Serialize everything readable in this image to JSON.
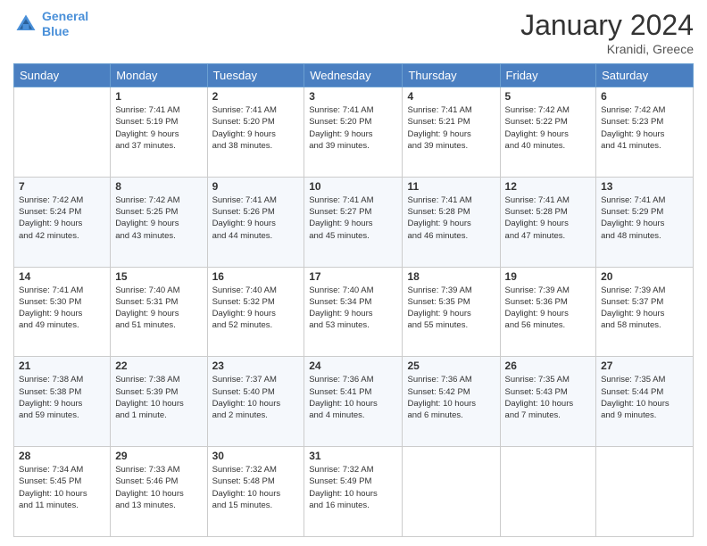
{
  "header": {
    "logo_line1": "General",
    "logo_line2": "Blue",
    "month_title": "January 2024",
    "location": "Kranidi, Greece"
  },
  "days_of_week": [
    "Sunday",
    "Monday",
    "Tuesday",
    "Wednesday",
    "Thursday",
    "Friday",
    "Saturday"
  ],
  "weeks": [
    [
      {
        "day": "",
        "info": ""
      },
      {
        "day": "1",
        "info": "Sunrise: 7:41 AM\nSunset: 5:19 PM\nDaylight: 9 hours\nand 37 minutes."
      },
      {
        "day": "2",
        "info": "Sunrise: 7:41 AM\nSunset: 5:20 PM\nDaylight: 9 hours\nand 38 minutes."
      },
      {
        "day": "3",
        "info": "Sunrise: 7:41 AM\nSunset: 5:20 PM\nDaylight: 9 hours\nand 39 minutes."
      },
      {
        "day": "4",
        "info": "Sunrise: 7:41 AM\nSunset: 5:21 PM\nDaylight: 9 hours\nand 39 minutes."
      },
      {
        "day": "5",
        "info": "Sunrise: 7:42 AM\nSunset: 5:22 PM\nDaylight: 9 hours\nand 40 minutes."
      },
      {
        "day": "6",
        "info": "Sunrise: 7:42 AM\nSunset: 5:23 PM\nDaylight: 9 hours\nand 41 minutes."
      }
    ],
    [
      {
        "day": "7",
        "info": "Sunrise: 7:42 AM\nSunset: 5:24 PM\nDaylight: 9 hours\nand 42 minutes."
      },
      {
        "day": "8",
        "info": "Sunrise: 7:42 AM\nSunset: 5:25 PM\nDaylight: 9 hours\nand 43 minutes."
      },
      {
        "day": "9",
        "info": "Sunrise: 7:41 AM\nSunset: 5:26 PM\nDaylight: 9 hours\nand 44 minutes."
      },
      {
        "day": "10",
        "info": "Sunrise: 7:41 AM\nSunset: 5:27 PM\nDaylight: 9 hours\nand 45 minutes."
      },
      {
        "day": "11",
        "info": "Sunrise: 7:41 AM\nSunset: 5:28 PM\nDaylight: 9 hours\nand 46 minutes."
      },
      {
        "day": "12",
        "info": "Sunrise: 7:41 AM\nSunset: 5:28 PM\nDaylight: 9 hours\nand 47 minutes."
      },
      {
        "day": "13",
        "info": "Sunrise: 7:41 AM\nSunset: 5:29 PM\nDaylight: 9 hours\nand 48 minutes."
      }
    ],
    [
      {
        "day": "14",
        "info": "Sunrise: 7:41 AM\nSunset: 5:30 PM\nDaylight: 9 hours\nand 49 minutes."
      },
      {
        "day": "15",
        "info": "Sunrise: 7:40 AM\nSunset: 5:31 PM\nDaylight: 9 hours\nand 51 minutes."
      },
      {
        "day": "16",
        "info": "Sunrise: 7:40 AM\nSunset: 5:32 PM\nDaylight: 9 hours\nand 52 minutes."
      },
      {
        "day": "17",
        "info": "Sunrise: 7:40 AM\nSunset: 5:34 PM\nDaylight: 9 hours\nand 53 minutes."
      },
      {
        "day": "18",
        "info": "Sunrise: 7:39 AM\nSunset: 5:35 PM\nDaylight: 9 hours\nand 55 minutes."
      },
      {
        "day": "19",
        "info": "Sunrise: 7:39 AM\nSunset: 5:36 PM\nDaylight: 9 hours\nand 56 minutes."
      },
      {
        "day": "20",
        "info": "Sunrise: 7:39 AM\nSunset: 5:37 PM\nDaylight: 9 hours\nand 58 minutes."
      }
    ],
    [
      {
        "day": "21",
        "info": "Sunrise: 7:38 AM\nSunset: 5:38 PM\nDaylight: 9 hours\nand 59 minutes."
      },
      {
        "day": "22",
        "info": "Sunrise: 7:38 AM\nSunset: 5:39 PM\nDaylight: 10 hours\nand 1 minute."
      },
      {
        "day": "23",
        "info": "Sunrise: 7:37 AM\nSunset: 5:40 PM\nDaylight: 10 hours\nand 2 minutes."
      },
      {
        "day": "24",
        "info": "Sunrise: 7:36 AM\nSunset: 5:41 PM\nDaylight: 10 hours\nand 4 minutes."
      },
      {
        "day": "25",
        "info": "Sunrise: 7:36 AM\nSunset: 5:42 PM\nDaylight: 10 hours\nand 6 minutes."
      },
      {
        "day": "26",
        "info": "Sunrise: 7:35 AM\nSunset: 5:43 PM\nDaylight: 10 hours\nand 7 minutes."
      },
      {
        "day": "27",
        "info": "Sunrise: 7:35 AM\nSunset: 5:44 PM\nDaylight: 10 hours\nand 9 minutes."
      }
    ],
    [
      {
        "day": "28",
        "info": "Sunrise: 7:34 AM\nSunset: 5:45 PM\nDaylight: 10 hours\nand 11 minutes."
      },
      {
        "day": "29",
        "info": "Sunrise: 7:33 AM\nSunset: 5:46 PM\nDaylight: 10 hours\nand 13 minutes."
      },
      {
        "day": "30",
        "info": "Sunrise: 7:32 AM\nSunset: 5:48 PM\nDaylight: 10 hours\nand 15 minutes."
      },
      {
        "day": "31",
        "info": "Sunrise: 7:32 AM\nSunset: 5:49 PM\nDaylight: 10 hours\nand 16 minutes."
      },
      {
        "day": "",
        "info": ""
      },
      {
        "day": "",
        "info": ""
      },
      {
        "day": "",
        "info": ""
      }
    ]
  ]
}
